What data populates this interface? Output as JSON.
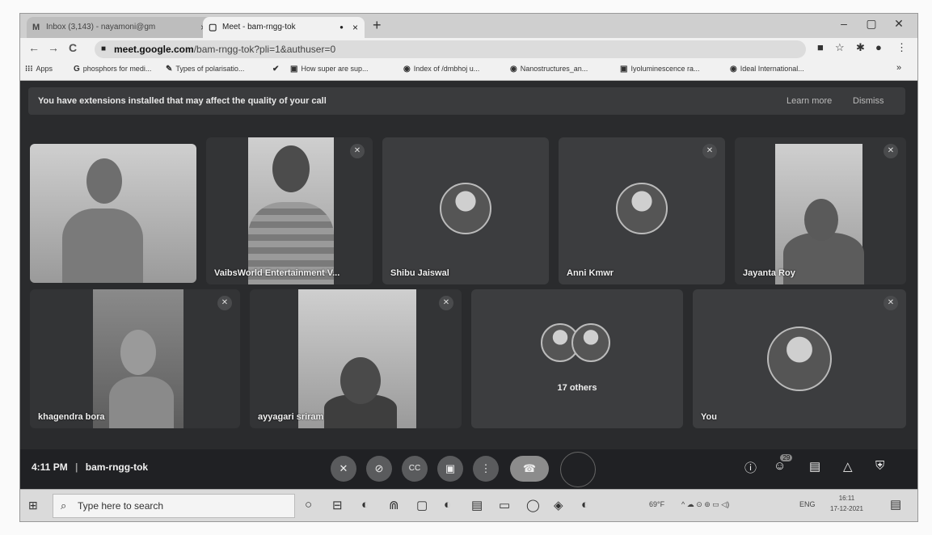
{
  "browser": {
    "tabs": [
      {
        "icon": "M",
        "title": "Inbox (3,143) - nayamoni@gm",
        "close": "×"
      },
      {
        "icon": "▢",
        "title": "Meet - bam-rngg-tok",
        "close": "×"
      }
    ],
    "record_dot": "●",
    "new_tab": "+",
    "window_controls": [
      "–",
      "▢",
      "✕"
    ],
    "nav": {
      "back": "←",
      "forward": "→",
      "reload": "C"
    },
    "address": {
      "host": "meet.google.com",
      "path": "/bam-rngg-tok?pli=1&authuser=0"
    },
    "address_icons": [
      "■",
      "☆",
      "✱",
      "●",
      "⋮"
    ],
    "bookmarks": [
      {
        "icon": "⁝⁝⁝",
        "label": "Apps"
      },
      {
        "icon": "G",
        "label": "phosphors for medi..."
      },
      {
        "icon": "✎",
        "label": "Types of polarisatio..."
      },
      {
        "icon": "✔",
        "label": ""
      },
      {
        "icon": "▣",
        "label": "How super are sup..."
      },
      {
        "icon": "◉",
        "label": "Index of /dmbhoj u..."
      },
      {
        "icon": "◉",
        "label": "Nanostructures_an..."
      },
      {
        "icon": "▣",
        "label": "Iyoluminescence ra..."
      },
      {
        "icon": "◉",
        "label": "Ideal International..."
      }
    ],
    "bookmarks_more": "»"
  },
  "meet": {
    "banner": {
      "message": "You have extensions installed that may affect the quality of your call",
      "learn_more": "Learn more",
      "dismiss": "Dismiss"
    },
    "participants": [
      {
        "name": ""
      },
      {
        "name": "VaibsWorld Entertainment V..."
      },
      {
        "name": "Shibu Jaiswal"
      },
      {
        "name": "Anni Kmwr"
      },
      {
        "name": "Jayanta Roy"
      },
      {
        "name": "khagendra bora"
      },
      {
        "name": "ayyagari sriram"
      },
      {
        "name": "17 others"
      },
      {
        "name": "You"
      }
    ],
    "mute_glyph": "✕",
    "footer": {
      "time": "4:11 PM",
      "separator": "|",
      "meeting_code": "bam-rngg-tok",
      "controls": {
        "mic": "✕",
        "camera": "⊘",
        "captions": "CC",
        "present": "▣",
        "more": "⋮",
        "end": "☎",
        "raise": ""
      },
      "right_controls": {
        "info": "ⓘ",
        "people": "☺",
        "people_count": "29",
        "chat": "▤",
        "activities": "△",
        "host": "⛨"
      }
    }
  },
  "taskbar": {
    "windows_icon": "⊞",
    "search_icon": "⌕",
    "search_placeholder": "Type here to search",
    "apps": [
      "○",
      "⊟",
      "◐",
      "⋒",
      "▢",
      "◐",
      "▤",
      "▭",
      "◯",
      "◈",
      "◐"
    ],
    "weather": "69°F",
    "tray_icons": "^ ☁ ⊙ ⊚ ▭ ◁)",
    "language": "ENG",
    "clock_time": "16:11",
    "clock_date": "17-12-2021",
    "notification_icon": "▤"
  }
}
